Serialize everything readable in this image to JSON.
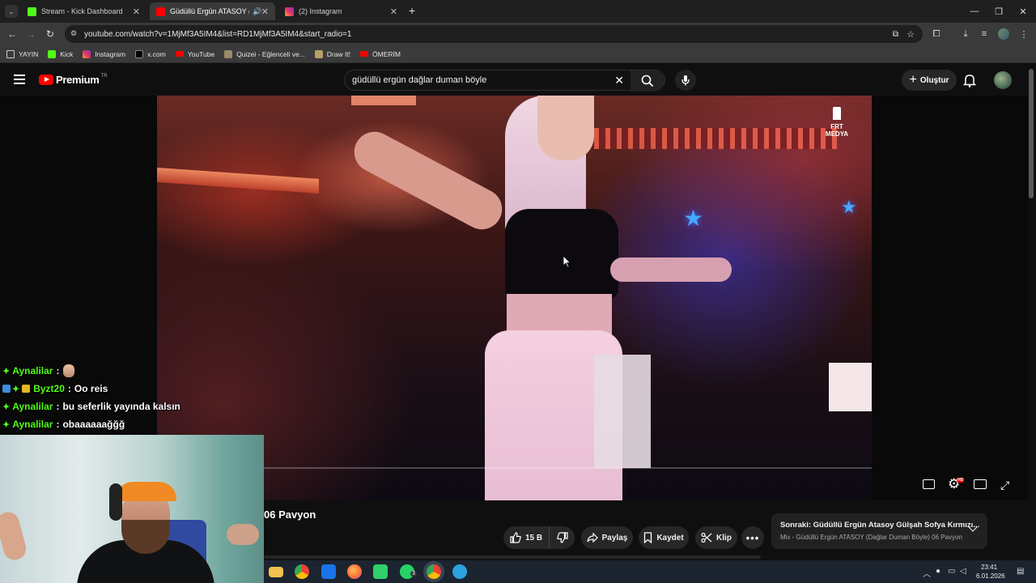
{
  "browser": {
    "tabs": [
      {
        "label": "Stream - Kick Dashboard",
        "active": false,
        "favicon": "kick-icon"
      },
      {
        "label": "Güdüllü Ergün ATASOY (Da",
        "active": true,
        "favicon": "youtube-icon"
      },
      {
        "label": "(2) Instagram",
        "active": false,
        "favicon": "instagram-icon"
      }
    ],
    "new_tab": "+",
    "url": "youtube.com/watch?v=1MjMf3A5IM4&list=RD1MjMf3A5IM4&start_radio=1",
    "bookmarks": [
      {
        "label": "YAYIN",
        "icon": "folder-icon"
      },
      {
        "label": "Kick",
        "icon": "kick-icon"
      },
      {
        "label": "Instagram",
        "icon": "instagram-icon"
      },
      {
        "label": "x.com",
        "icon": "x-icon"
      },
      {
        "label": "YouTube",
        "icon": "youtube-icon"
      },
      {
        "label": "Quizei - Eğlenceli ve...",
        "icon": "quiz-icon"
      },
      {
        "label": "Draw It!",
        "icon": "draw-icon"
      },
      {
        "label": "ÖMERİM",
        "icon": "youtube-icon"
      }
    ]
  },
  "youtube": {
    "logo_text": "Premium",
    "logo_badge": "TR",
    "search_value": "güdüllü ergün dağlar duman böyle",
    "create_label": "Oluştur",
    "watermark": "FRT MEDYA",
    "title_visible": "06 Pavyon",
    "like_count": "15 B",
    "share_label": "Paylaş",
    "save_label": "Kaydet",
    "clip_label": "Klip",
    "next_title": "Sonraki: Güdüllü Ergün Atasoy Gülşah Sofya Kırmızı...",
    "next_subtitle": "Mix - Güdüllü Ergün ATASOY (Dağlar Duman Böyle) 06 Pavyon",
    "hd_badge": "HD"
  },
  "chat": [
    {
      "user": "Aynalilar",
      "message": "",
      "badges": "gem"
    },
    {
      "user": "Byzt20",
      "message": "Oo reis",
      "badges": "multi"
    },
    {
      "user": "Aynalilar",
      "message": "bu seferlik yayında kalsın",
      "badges": "gem"
    },
    {
      "user": "Aynalilar",
      "message": "obaaaaaağğğ",
      "badges": "gem"
    }
  ],
  "taskbar": {
    "time": "23:41",
    "date": "6.01.2026",
    "whatsapp_badge": "3"
  },
  "colors": {
    "kick_green": "#53fc18",
    "youtube_red": "#ff0000",
    "background": "#0f0f0f"
  }
}
